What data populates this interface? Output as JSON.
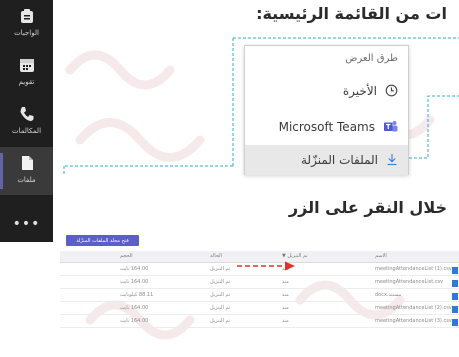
{
  "rail": {
    "items": [
      {
        "label": "الواجبات",
        "icon": "assignments-icon"
      },
      {
        "label": "تقويم",
        "icon": "calendar-icon"
      },
      {
        "label": "المكالمات",
        "icon": "calls-icon"
      },
      {
        "label": "ملفات",
        "icon": "files-icon",
        "active": true
      }
    ],
    "more": "•••"
  },
  "headings": {
    "top": "ات من القائمة الرئيسية:",
    "middle": "خلال النقر على الزر"
  },
  "menu": {
    "title": "طرق العرض",
    "items": [
      {
        "label": "الأخيرة",
        "icon": "clock-icon"
      },
      {
        "label": "Microsoft Teams",
        "icon": "teams-icon"
      },
      {
        "label": "الملفات المنزّلة",
        "icon": "download-icon",
        "selected": true
      }
    ]
  },
  "table": {
    "download_button": "فتح مجلد الملفات المنزّلة",
    "headers": {
      "name": "الاسم",
      "date": "تم التنزيل ▼",
      "location": "الحالة",
      "size": "الحجم"
    },
    "rows": [
      {
        "name": "meetingAttendanceList (1).csv",
        "date": "منذ",
        "location": "تم التنزيل",
        "size": "164.00 بايت"
      },
      {
        "name": "meetingAttendanceList.csv",
        "date": "منذ",
        "location": "تم التنزيل",
        "size": "164.00 بايت"
      },
      {
        "name": "مستند.docx",
        "date": "منذ",
        "location": "تم التنزيل",
        "size": "88.11 كيلوبايت"
      },
      {
        "name": "meetingAttendanceList (2).csv",
        "date": "منذ",
        "location": "تم التنزيل",
        "size": "164.00 بايت"
      },
      {
        "name": "meetingAttendanceList (3).csv",
        "date": "منذ",
        "location": "تم التنزيل",
        "size": "164.00 بايت"
      }
    ]
  },
  "colors": {
    "rail_bg": "#1f1f1f",
    "accent": "#6264a7",
    "guide": "#3aa6d6",
    "arrow": "#e0312b"
  }
}
